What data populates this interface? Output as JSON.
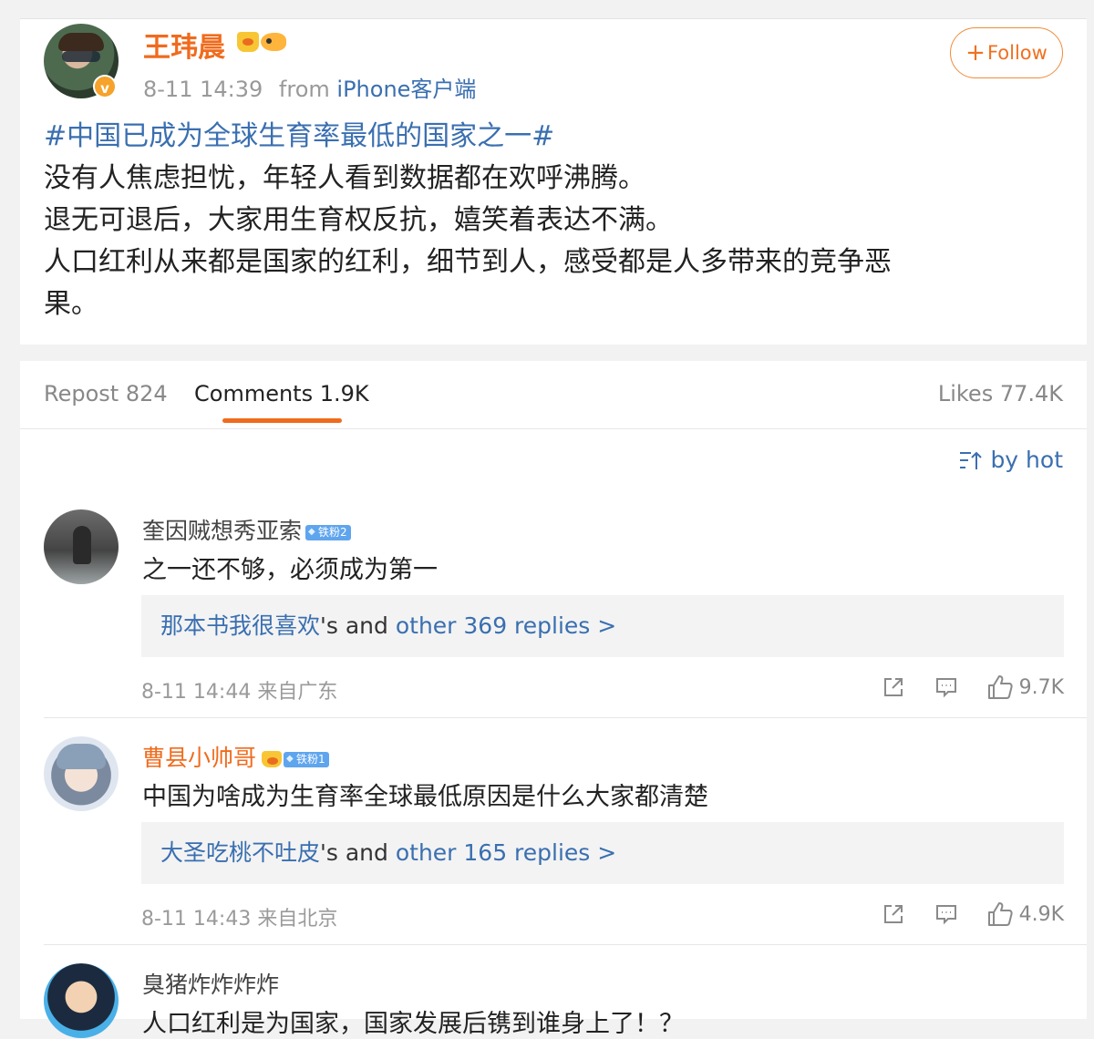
{
  "post": {
    "author": "王玮晨",
    "verified_mark": "v",
    "timestamp": "8-11 14:39",
    "from_prefix": "from",
    "source": "iPhone客户端",
    "follow_label": "Follow",
    "hashtag": "#中国已成为全球生育率最低的国家之一#",
    "body_lines": [
      "没有人焦虑担忧，年轻人看到数据都在欢呼沸腾。",
      "退无可退后，大家用生育权反抗，嬉笑着表达不满。",
      "人口红利从来都是国家的红利，细节到人，感受都是人多带来的竞争恶",
      "果。"
    ]
  },
  "tabs": {
    "repost": "Repost 824",
    "comments": "Comments 1.9K",
    "likes": "Likes 77.4K"
  },
  "sort": {
    "label": "by hot"
  },
  "comments": [
    {
      "name": "奎因贼想秀亚索",
      "badge": "铁粉2",
      "text": "之一还不够，必须成为第一",
      "reply_user": "那本书我很喜欢",
      "reply_mid": "'s and ",
      "reply_more": "other 369 replies >",
      "time": "8-11 14:44 来自广东",
      "likes": "9.7K"
    },
    {
      "name": "曹县小帅哥",
      "badge": "铁粉1",
      "text": "中国为啥成为生育率全球最低原因是什么大家都清楚",
      "reply_user": "大圣吃桃不吐皮",
      "reply_mid": "'s and ",
      "reply_more": "other 165 replies >",
      "time": "8-11 14:43 来自北京",
      "likes": "4.9K"
    },
    {
      "name": "臭猪炸炸炸炸",
      "text": "人口红利是为国家，国家发展后镌到谁身上了！？"
    }
  ],
  "colors": {
    "accent_orange": "#f06b1d",
    "link_blue": "#3a6fb0",
    "fan_badge_blue": "#5fa5ee"
  },
  "icons": [
    "crown-icon",
    "fish-icon",
    "plus-icon",
    "sort-icon",
    "share-icon",
    "comment-icon",
    "like-icon",
    "fan-badge-icon"
  ]
}
